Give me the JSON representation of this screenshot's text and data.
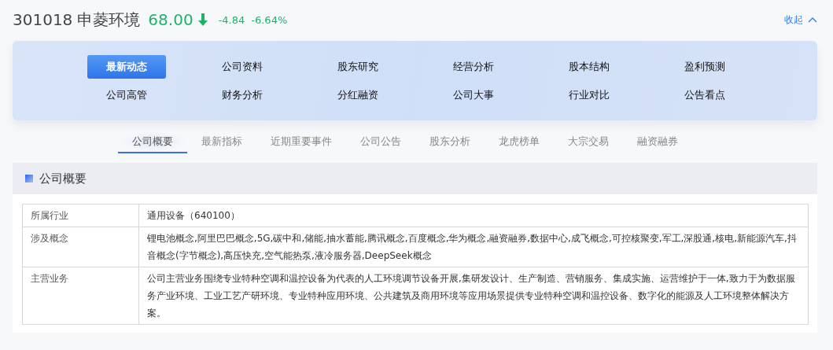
{
  "header": {
    "code": "301018",
    "name": "申菱环境",
    "price": "68.00",
    "falling": true,
    "change": "-4.84",
    "change_pct": "-6.64%",
    "collapse": "收起"
  },
  "nav": [
    {
      "label": "最新动态",
      "selected": true
    },
    {
      "label": "公司资料",
      "selected": false
    },
    {
      "label": "股东研究",
      "selected": false
    },
    {
      "label": "经营分析",
      "selected": false
    },
    {
      "label": "股本结构",
      "selected": false
    },
    {
      "label": "盈利预测",
      "selected": false
    },
    {
      "label": "公司高管",
      "selected": false
    },
    {
      "label": "财务分析",
      "selected": false
    },
    {
      "label": "分红融资",
      "selected": false
    },
    {
      "label": "公司大事",
      "selected": false
    },
    {
      "label": "行业对比",
      "selected": false
    },
    {
      "label": "公告看点",
      "selected": false
    }
  ],
  "tabs": [
    {
      "label": "公司概要",
      "selected": true
    },
    {
      "label": "最新指标",
      "selected": false
    },
    {
      "label": "近期重要事件",
      "selected": false
    },
    {
      "label": "公司公告",
      "selected": false
    },
    {
      "label": "股东分析",
      "selected": false
    },
    {
      "label": "龙虎榜单",
      "selected": false
    },
    {
      "label": "大宗交易",
      "selected": false
    },
    {
      "label": "融资融券",
      "selected": false
    }
  ],
  "section": {
    "title": "公司概要",
    "rows": [
      {
        "label": "所属行业",
        "value": "通用设备（640100）"
      },
      {
        "label": "涉及概念",
        "value": "锂电池概念,阿里巴巴概念,5G,碳中和,储能,抽水蓄能,腾讯概念,百度概念,华为概念,融资融券,数据中心,成飞概念,可控核聚变,军工,深股通,核电,新能源汽车,抖音概念(字节概念),高压快充,空气能热泵,液冷服务器,DeepSeek概念"
      },
      {
        "label": "主营业务",
        "value": "公司主营业务围绕专业特种空调和温控设备为代表的人工环境调节设备开展,集研发设计、生产制造、营销服务、集成实施、运营维护于一体,致力于为数据服务产业环境、工业工艺产研环境、专业特种应用环境、公共建筑及商用环境等应用场景提供专业特种空调和温控设备、数字化的能源及人工环境整体解决方案。"
      }
    ]
  }
}
